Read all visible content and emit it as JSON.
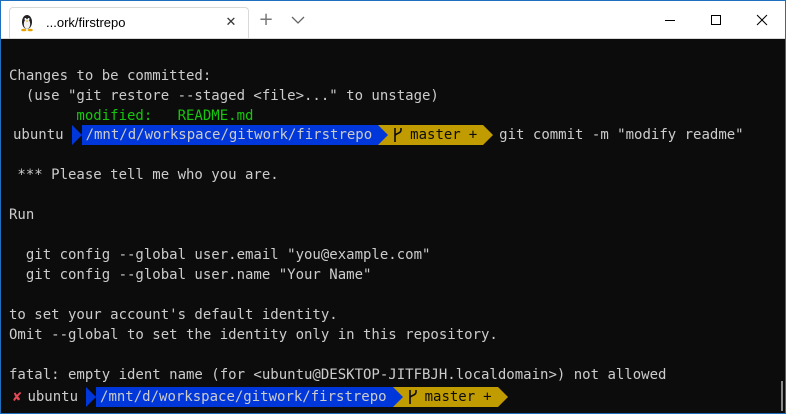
{
  "tab": {
    "title": "...ork/firstrepo",
    "icon": "linux-penguin-icon",
    "close_glyph": "✕"
  },
  "new_tab_glyph": "+",
  "colors": {
    "terminal_bg": "#0c0c0c",
    "text": "#cccccc",
    "path_bg": "#0037da",
    "git_bg": "#c19c00",
    "staged_green": "#16c60c",
    "error_red": "#e74856"
  },
  "terminal": {
    "line1": "Changes to be committed:",
    "line2": "  (use \"git restore --staged <file>...\" to unstage)",
    "line3": "        modified:   README.md",
    "prompt1": {
      "user": "ubuntu",
      "path": "/mnt/d/workspace/gitwork/firstrepo",
      "branch": "master",
      "branch_suffix": "+",
      "command": "git commit -m \"modify readme\""
    },
    "line5": " *** Please tell me who you are.",
    "line6": "Run",
    "line7": "  git config --global user.email \"you@example.com\"",
    "line8": "  git config --global user.name \"Your Name\"",
    "line9": "to set your account's default identity.",
    "line10": "Omit --global to set the identity only in this repository.",
    "line11": "fatal: empty ident name (for <ubuntu@DESKTOP-JITFBJH.localdomain>) not allowed",
    "prompt2": {
      "status": "✘",
      "user": "ubuntu",
      "path": "/mnt/d/workspace/gitwork/firstrepo",
      "branch": "master",
      "branch_suffix": "+"
    }
  }
}
